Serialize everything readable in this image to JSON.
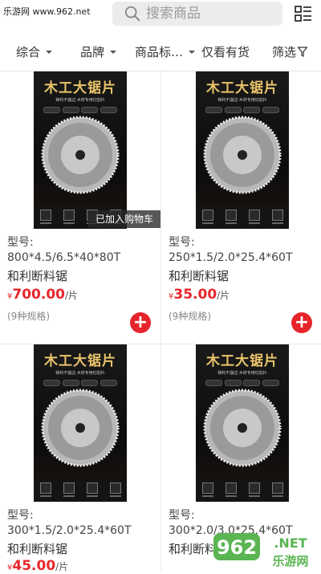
{
  "watermark": "乐游网 www.962.net",
  "search": {
    "placeholder": "搜索商品"
  },
  "filters": [
    {
      "label": "综合"
    },
    {
      "label": "品牌"
    },
    {
      "label": "商品标…"
    },
    {
      "label": "仅看有货"
    },
    {
      "label": "筛选"
    }
  ],
  "product_image": {
    "title": "木工大锯片",
    "subtitle": "锋利不崩边 木材专用切割片"
  },
  "cart_toast": "已加入购物车",
  "products": [
    {
      "model_label": "型号:",
      "spec": "800*4.5/6.5*40*80T",
      "name": "和利断料锯",
      "currency": "¥",
      "price": "700.00",
      "unit": "/片",
      "variants": "(9种规格)"
    },
    {
      "model_label": "型号:",
      "spec": "250*1.5/2.0*25.4*60T",
      "name": "和利断料锯",
      "currency": "¥",
      "price": "35.00",
      "unit": "/片",
      "variants": "(9种规格)"
    },
    {
      "model_label": "型号:",
      "spec": "300*1.5/2.0*25.4*60T",
      "name": "和利断料锯",
      "currency": "¥",
      "price": "45.00",
      "unit": "/片",
      "variants": ""
    },
    {
      "model_label": "型号:",
      "spec": "300*2.0/3.0*25.4*60T",
      "name": "和利断料锯",
      "currency": "¥",
      "price": "",
      "unit": "",
      "variants": ""
    }
  ],
  "site_logo": {
    "number": "962",
    "domain": ".NET",
    "name": "乐游网"
  },
  "colors": {
    "accent": "#e5242b",
    "price": "#e8262a",
    "gold": "#e8c36a"
  }
}
